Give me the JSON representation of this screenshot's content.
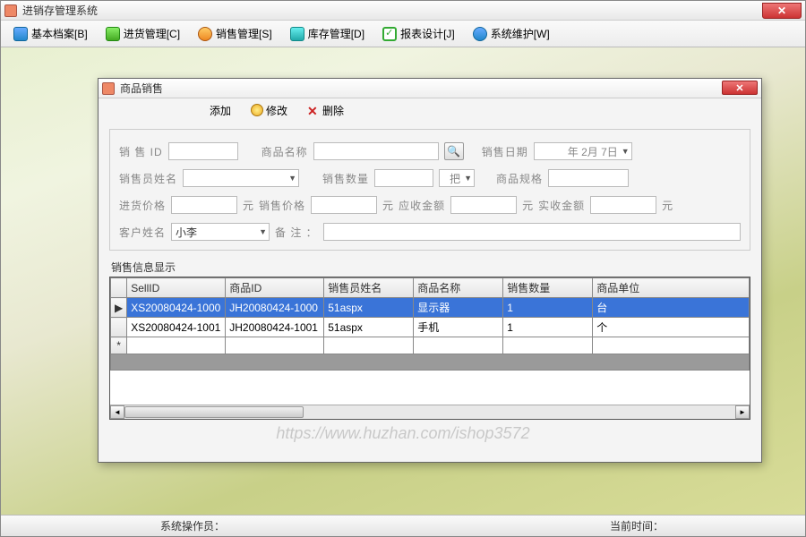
{
  "app": {
    "title": "进销存管理系统"
  },
  "menu": {
    "basic": "基本档案[B]",
    "purchase": "进货管理[C]",
    "sales": "销售管理[S]",
    "stock": "库存管理[D]",
    "report": "报表设计[J]",
    "maintain": "系统维护[W]"
  },
  "child": {
    "title": "商品销售",
    "toolbar": {
      "add": "添加",
      "edit": "修改",
      "delete": "删除"
    }
  },
  "form": {
    "sell_id_label": "销 售 ID",
    "product_name_label": "商品名称",
    "sell_date_label": "销售日期",
    "sell_date_value": "年 2月 7日",
    "seller_name_label": "销售员姓名",
    "sell_qty_label": "销售数量",
    "unit_option": "把",
    "product_spec_label": "商品规格",
    "purchase_price_label": "进货价格",
    "sell_price_label": "销售价格",
    "receivable_label": "应收金额",
    "received_label": "实收金额",
    "currency_unit": "元",
    "customer_name_label": "客户姓名",
    "customer_name_value": "小李",
    "remark_label": "备   注 ："
  },
  "grid": {
    "title": "销售信息显示",
    "cols": {
      "sell_id": "SellID",
      "product_id": "商品ID",
      "seller": "销售员姓名",
      "product_name": "商品名称",
      "qty": "销售数量",
      "unit": "商品单位"
    },
    "rows": [
      {
        "sell_id": "XS20080424-1000",
        "product_id": "JH20080424-1000",
        "seller": "51aspx",
        "product_name": "显示器",
        "qty": "1",
        "unit": "台"
      },
      {
        "sell_id": "XS20080424-1001",
        "product_id": "JH20080424-1001",
        "seller": "51aspx",
        "product_name": "手机",
        "qty": "1",
        "unit": "个"
      }
    ],
    "row_pointer": "▶",
    "new_row": "*"
  },
  "status": {
    "operator_label": "系统操作员：",
    "time_label": "当前时间："
  },
  "watermark": "https://www.huzhan.com/ishop3572"
}
